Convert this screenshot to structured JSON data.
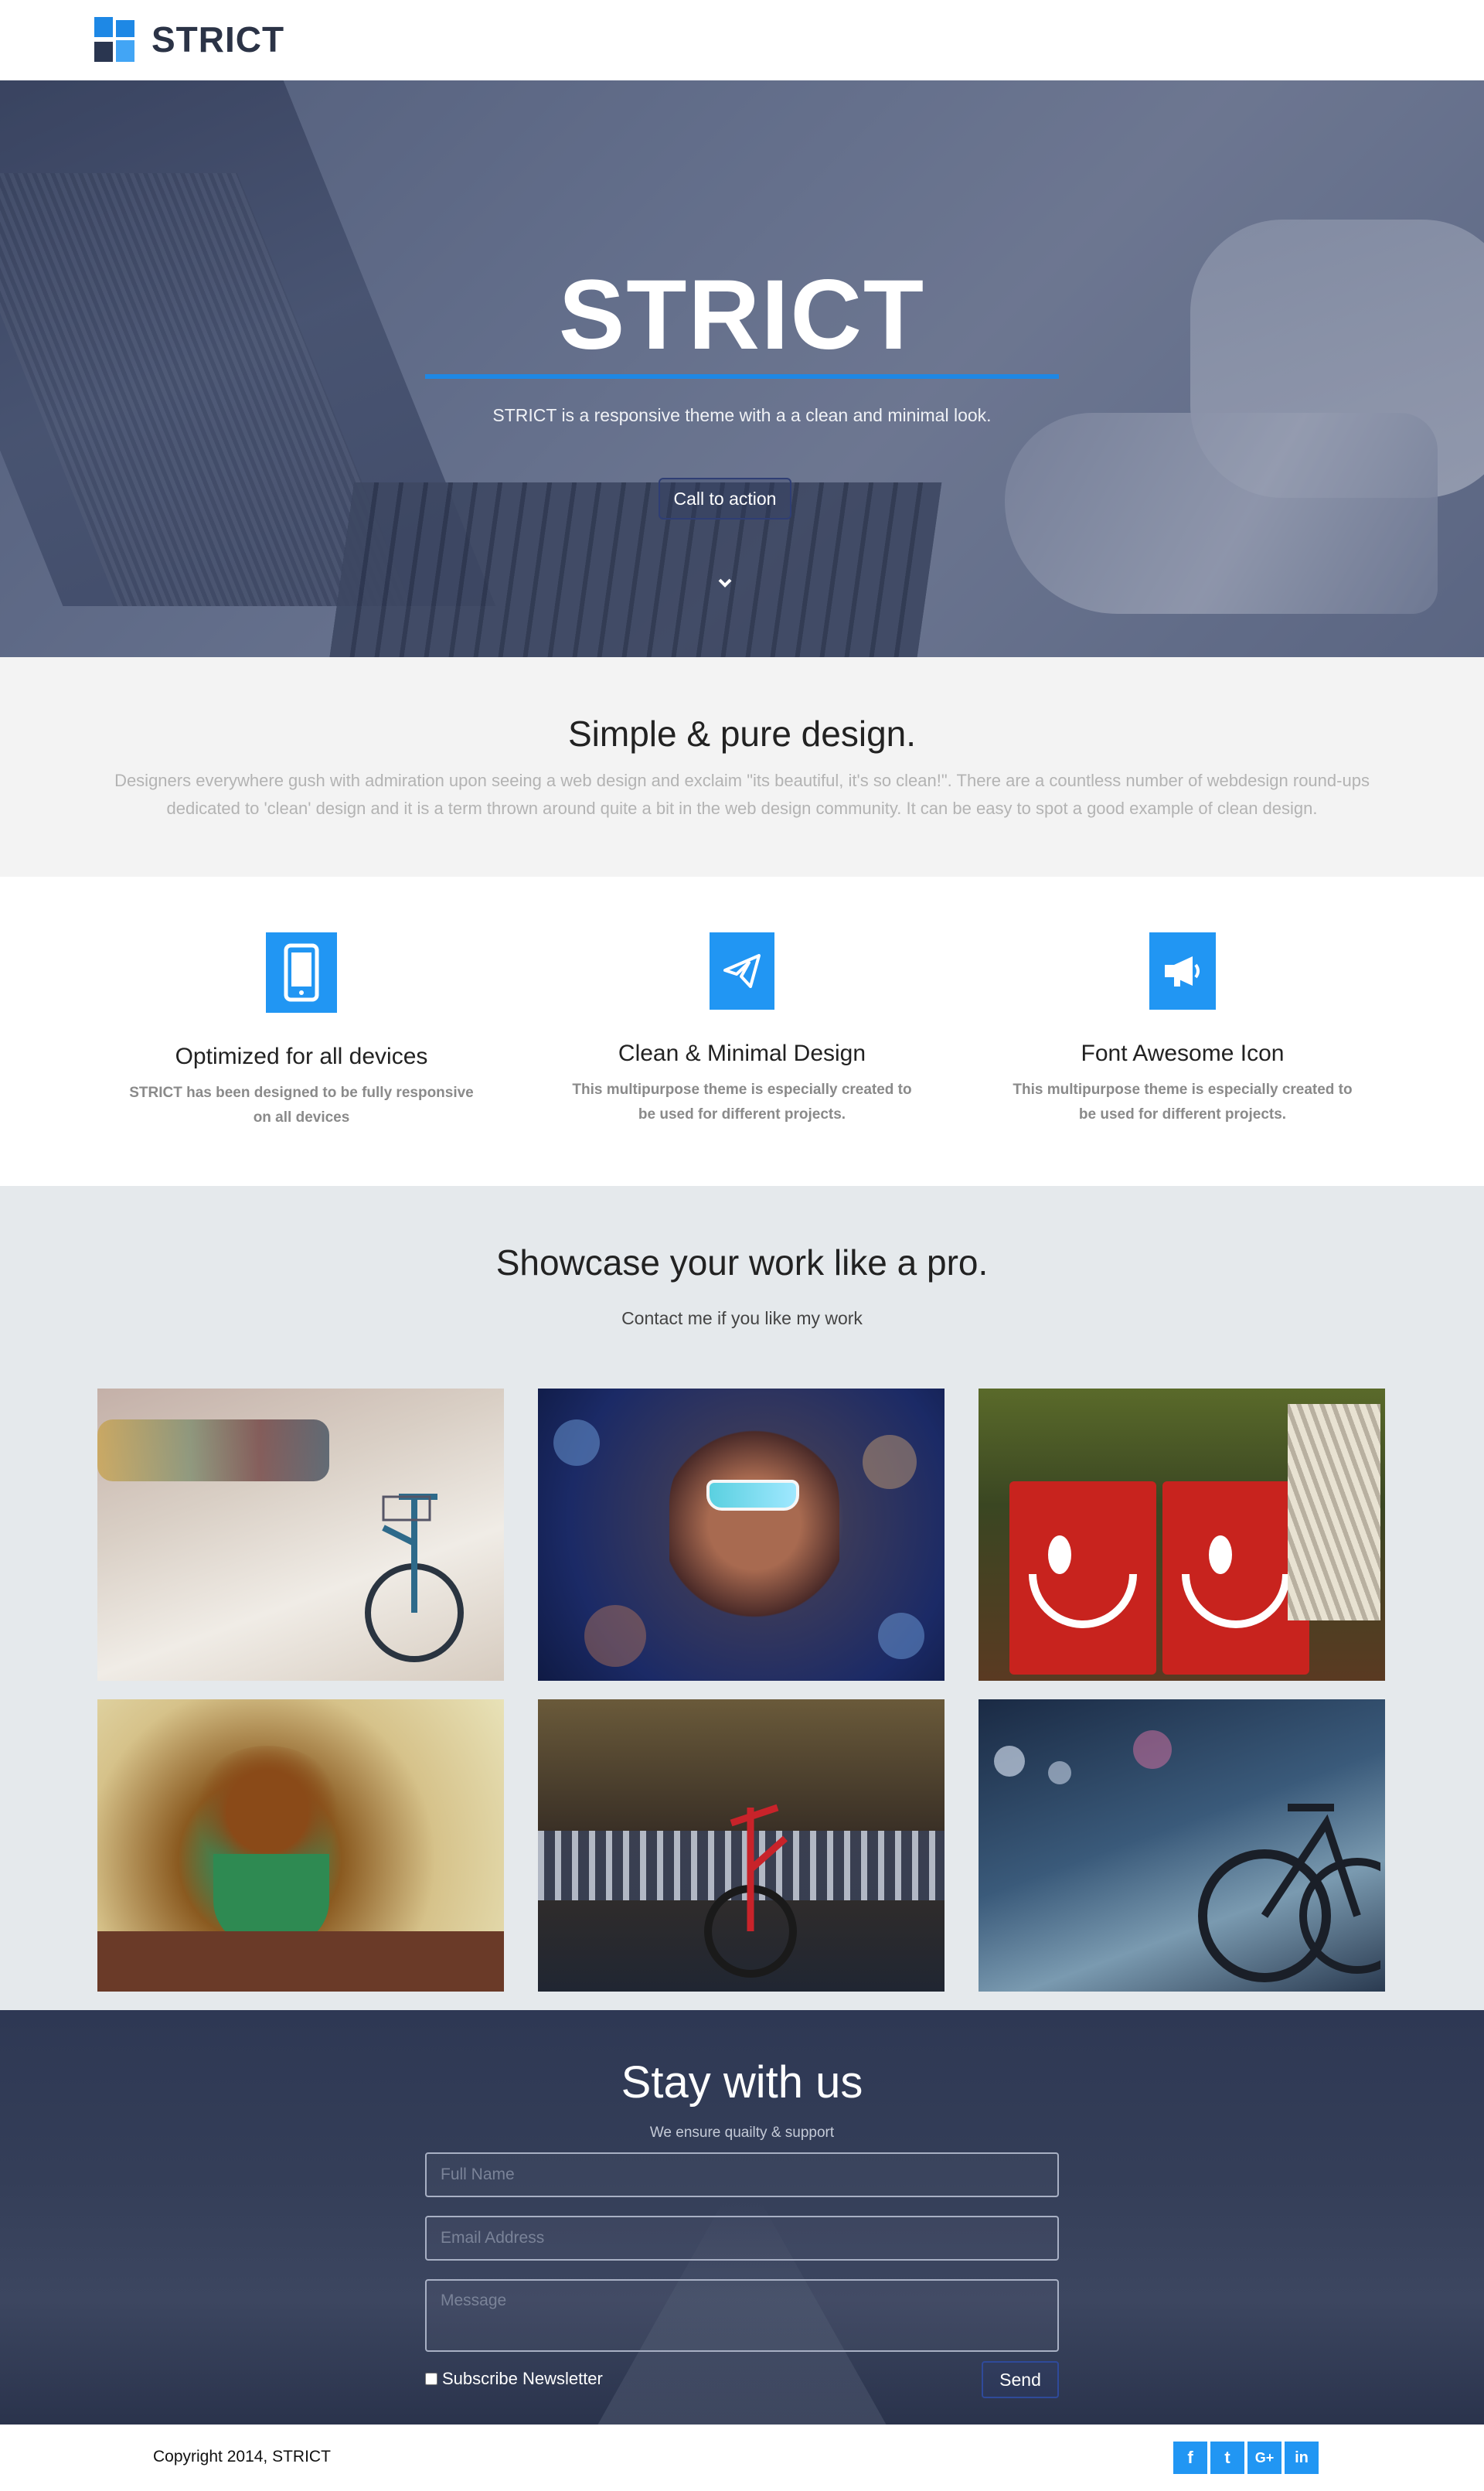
{
  "header": {
    "brand": "STRICT"
  },
  "hero": {
    "title": "STRICT",
    "subtitle": "STRICT is a responsive theme with a a clean and minimal look.",
    "cta_label": "Call to action"
  },
  "intro": {
    "title": "Simple & pure design.",
    "text": "Designers everywhere gush with admiration upon seeing a web design and exclaim \"its beautiful, it's so clean!\". There are a countless number of webdesign round-ups dedicated to 'clean' design and it is a term thrown around quite a bit in the web design community. It can be easy to spot a good example of clean design."
  },
  "features": [
    {
      "icon": "mobile-icon",
      "title": "Optimized for all devices",
      "text": "STRICT has been designed to be fully responsive on all devices"
    },
    {
      "icon": "paper-plane-icon",
      "title": "Clean & Minimal Design",
      "text": "This multipurpose theme is especially created to be used for different projects."
    },
    {
      "icon": "bullhorn-icon",
      "title": "Font Awesome Icon",
      "text": "This multipurpose theme is especially created to be used for different projects."
    }
  ],
  "showcase": {
    "title": "Showcase your work like a pro.",
    "subtitle": "Contact me if you like my work"
  },
  "contact": {
    "title": "Stay with us",
    "tagline": "We ensure quailty & support",
    "name_placeholder": "Full Name",
    "email_placeholder": "Email Address",
    "message_placeholder": "Message",
    "newsletter_label": "Subscribe Newsletter",
    "send_label": "Send"
  },
  "footer": {
    "copyright": "Copyright 2014, STRICT",
    "social": [
      "f",
      "t",
      "G+",
      "in"
    ]
  },
  "colors": {
    "accent": "#2196f3",
    "dark": "#2b3346"
  }
}
